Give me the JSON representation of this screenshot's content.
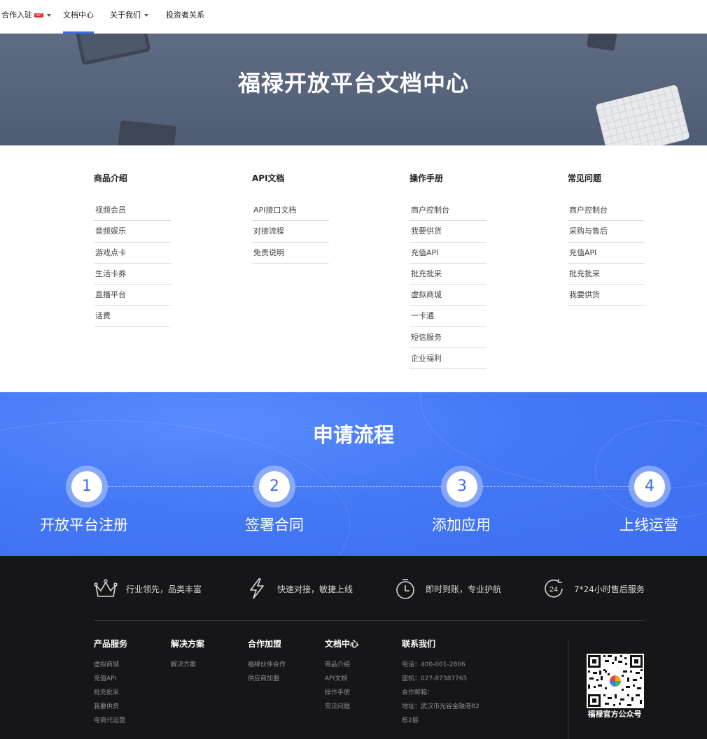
{
  "nav": {
    "items": [
      {
        "label": "合作入驻",
        "hot": "HOT",
        "dropdown": true
      },
      {
        "label": "文档中心",
        "active": true
      },
      {
        "label": "关于我们",
        "dropdown": true
      },
      {
        "label": "投资者关系"
      }
    ]
  },
  "hero": {
    "title": "福禄开放平台文档中心"
  },
  "docs": {
    "columns": [
      {
        "title": "商品介绍",
        "items": [
          "视频会员",
          "音频娱乐",
          "游戏点卡",
          "生活卡券",
          "直播平台",
          "话费"
        ]
      },
      {
        "title": "API文档",
        "items": [
          "API接口文档",
          "对接流程",
          "免责说明"
        ]
      },
      {
        "title": "操作手册",
        "items": [
          "商户控制台",
          "我要供货",
          "充值API",
          "批充批采",
          "虚拟商城",
          "一卡通",
          "短信服务",
          "企业福利"
        ]
      },
      {
        "title": "常见问题",
        "items": [
          "商户控制台",
          "采购与售后",
          "充值API",
          "批充批采",
          "我要供货"
        ]
      }
    ]
  },
  "process": {
    "title": "申请流程",
    "steps": [
      {
        "num": "1",
        "label": "开放平台注册"
      },
      {
        "num": "2",
        "label": "签署合同"
      },
      {
        "num": "3",
        "label": "添加应用"
      },
      {
        "num": "4",
        "label": "上线运营"
      }
    ]
  },
  "footer": {
    "features": [
      {
        "icon": "crown-icon",
        "text": "行业领先，品类丰富"
      },
      {
        "icon": "lightning-icon",
        "text": "快速对接，敏捷上线"
      },
      {
        "icon": "stopwatch-icon",
        "text": "即时到账，专业护航"
      },
      {
        "icon": "24-hour-icon",
        "icon_text": "24",
        "text": "7*24小时售后服务"
      }
    ],
    "columns": [
      {
        "title": "产品服务",
        "links": [
          "虚拟商城",
          "充值API",
          "批充批采",
          "我要供货",
          "电商代运营"
        ]
      },
      {
        "title": "解决方案",
        "links": [
          "解决方案"
        ]
      },
      {
        "title": "合作加盟",
        "links": [
          "福禄伙伴合作",
          "供应商加盟"
        ]
      },
      {
        "title": "文档中心",
        "links": [
          "商品介绍",
          "API文档",
          "操作手册",
          "常见问题"
        ]
      }
    ],
    "contact": {
      "title": "联系我们",
      "phone": "电话：400-001-2806",
      "landline": "座机：027-87387765",
      "email": "合作邮箱：",
      "address_line1": "地址：武汉市光谷金融港B2",
      "address_line2": "栋2层"
    },
    "qr_caption": "福禄官方公众号"
  }
}
